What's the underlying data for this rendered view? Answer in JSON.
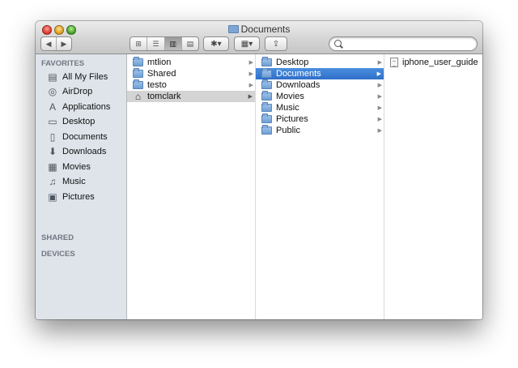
{
  "window": {
    "title": "Documents"
  },
  "toolbar": {
    "nav": {
      "back": "◀",
      "forward": "▶"
    },
    "views": [
      "⊞",
      "☰",
      "▥",
      "▤"
    ],
    "action": "✱▾",
    "arrange": "▦▾",
    "share": "⇪"
  },
  "search": {
    "value": "",
    "placeholder": ""
  },
  "sidebar": {
    "favorites_heading": "FAVORITES",
    "favorites": [
      {
        "label": "All My Files",
        "icon": "all-files-icon"
      },
      {
        "label": "AirDrop",
        "icon": "airdrop-icon"
      },
      {
        "label": "Applications",
        "icon": "applications-icon"
      },
      {
        "label": "Desktop",
        "icon": "desktop-icon"
      },
      {
        "label": "Documents",
        "icon": "documents-icon"
      },
      {
        "label": "Downloads",
        "icon": "downloads-icon"
      },
      {
        "label": "Movies",
        "icon": "movies-icon"
      },
      {
        "label": "Music",
        "icon": "music-icon"
      },
      {
        "label": "Pictures",
        "icon": "pictures-icon"
      }
    ],
    "shared_heading": "SHARED",
    "devices_heading": "DEVICES"
  },
  "columns": [
    {
      "items": [
        "mtlion",
        "Shared",
        "testo",
        "tomclark"
      ],
      "selected": "tomclark"
    },
    {
      "items": [
        "Desktop",
        "Documents",
        "Downloads",
        "Movies",
        "Music",
        "Pictures",
        "Public"
      ],
      "selected": "Documents"
    },
    {
      "items": [
        "iphone_user_guide"
      ]
    }
  ]
}
